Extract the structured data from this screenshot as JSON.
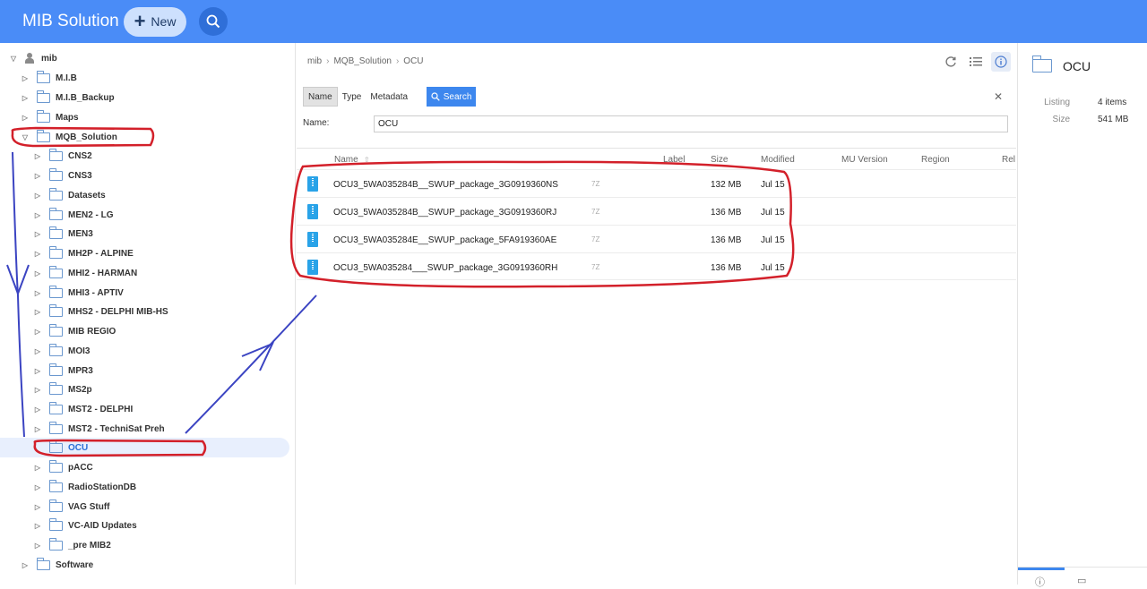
{
  "header": {
    "app_title": "MIB Solution",
    "new_label": "New",
    "accent": "#4a8cf7"
  },
  "sidebar": {
    "root": "mib",
    "items": [
      {
        "label": "M.I.B"
      },
      {
        "label": "M.I.B_Backup"
      },
      {
        "label": "Maps"
      },
      {
        "label": "MQB_Solution"
      },
      {
        "label": "CNS2"
      },
      {
        "label": "CNS3"
      },
      {
        "label": "Datasets"
      },
      {
        "label": "MEN2 - LG"
      },
      {
        "label": "MEN3"
      },
      {
        "label": "MH2P - ALPINE"
      },
      {
        "label": "MHI2 - HARMAN"
      },
      {
        "label": "MHI3 - APTIV"
      },
      {
        "label": "MHS2 - DELPHI MIB-HS"
      },
      {
        "label": "MIB REGIO"
      },
      {
        "label": "MOI3"
      },
      {
        "label": "MPR3"
      },
      {
        "label": "MS2p"
      },
      {
        "label": "MST2 - DELPHI"
      },
      {
        "label": "MST2 - TechniSat Preh"
      },
      {
        "label": "OCU"
      },
      {
        "label": "pACC"
      },
      {
        "label": "RadioStationDB"
      },
      {
        "label": "VAG Stuff"
      },
      {
        "label": "VC-AID Updates"
      },
      {
        "label": "_pre MIB2"
      },
      {
        "label": "Software"
      }
    ]
  },
  "breadcrumb": {
    "items": [
      "mib",
      "MQB_Solution",
      "OCU"
    ],
    "separator": "›"
  },
  "filter": {
    "tabs": [
      "Name",
      "Type",
      "Metadata"
    ],
    "search_label": "Search",
    "name_label": "Name:",
    "name_value": "OCU"
  },
  "table": {
    "headers": {
      "name": "Name",
      "label": "Label",
      "size": "Size",
      "modified": "Modified",
      "mu_version": "MU Version",
      "region": "Region",
      "rel": "Rel"
    },
    "rows": [
      {
        "name": "OCU3_5WA035284B__SWUP_package_3G0919360NS",
        "label": "7Z",
        "size": "132 MB",
        "modified": "Jul 15"
      },
      {
        "name": "OCU3_5WA035284B__SWUP_package_3G0919360RJ",
        "label": "7Z",
        "size": "136 MB",
        "modified": "Jul 15"
      },
      {
        "name": "OCU3_5WA035284E__SWUP_package_5FA919360AE",
        "label": "7Z",
        "size": "136 MB",
        "modified": "Jul 15"
      },
      {
        "name": "OCU3_5WA035284___SWUP_package_3G0919360RH",
        "label": "7Z",
        "size": "136 MB",
        "modified": "Jul 15"
      }
    ]
  },
  "detail": {
    "title": "OCU",
    "listing_label": "Listing",
    "listing_value": "4 items",
    "size_label": "Size",
    "size_value": "541 MB"
  }
}
